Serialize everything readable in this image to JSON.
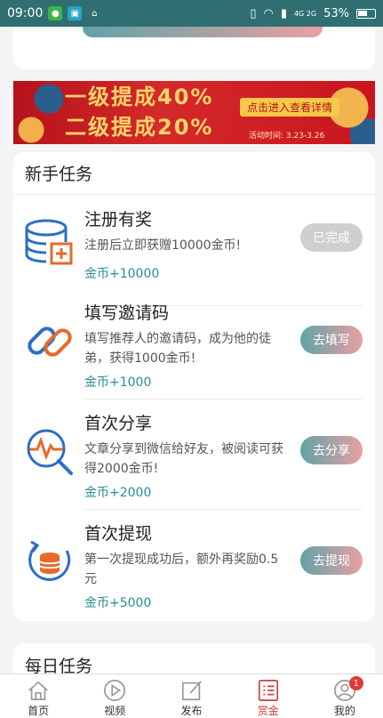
{
  "status_bar": {
    "time": "09:00",
    "carrier": "4G 2G",
    "battery": "53%"
  },
  "banner": {
    "line1": "一级提成40%",
    "line2": "二级提成20%",
    "cta": "点击进入查看详情",
    "date": "活动时间: 3.23-3.26"
  },
  "newbie": {
    "title": "新手任务",
    "tasks": [
      {
        "title": "注册有奖",
        "desc": "注册后立即获赠10000金币!",
        "reward": "金币+10000",
        "button": "已完成",
        "icon": "database-plus-icon"
      },
      {
        "title": "填写邀请码",
        "desc": "填写推荐人的邀请码，成为他的徒弟，获得1000金币!",
        "reward": "金币+1000",
        "button": "去填写",
        "icon": "link-icon"
      },
      {
        "title": "首次分享",
        "desc": "文章分享到微信给好友，被阅读可获得2000金币!",
        "reward": "金币+2000",
        "button": "去分享",
        "icon": "pulse-search-icon"
      },
      {
        "title": "首次提现",
        "desc": "第一次提现成功后，额外再奖励0.5元",
        "reward": "金币+5000",
        "button": "去提现",
        "icon": "coin-refresh-icon"
      }
    ]
  },
  "daily": {
    "title": "每日任务"
  },
  "tabbar": {
    "tabs": [
      {
        "label": "首页",
        "icon": "home-icon"
      },
      {
        "label": "视频",
        "icon": "play-icon"
      },
      {
        "label": "发布",
        "icon": "edit-icon"
      },
      {
        "label": "赏金",
        "icon": "list-icon",
        "active": true
      },
      {
        "label": "我的",
        "icon": "user-icon",
        "badge": "1"
      }
    ]
  },
  "colors": {
    "accent": "#2a8d92",
    "active_tab": "#c94040",
    "badge": "#e03a3a"
  }
}
